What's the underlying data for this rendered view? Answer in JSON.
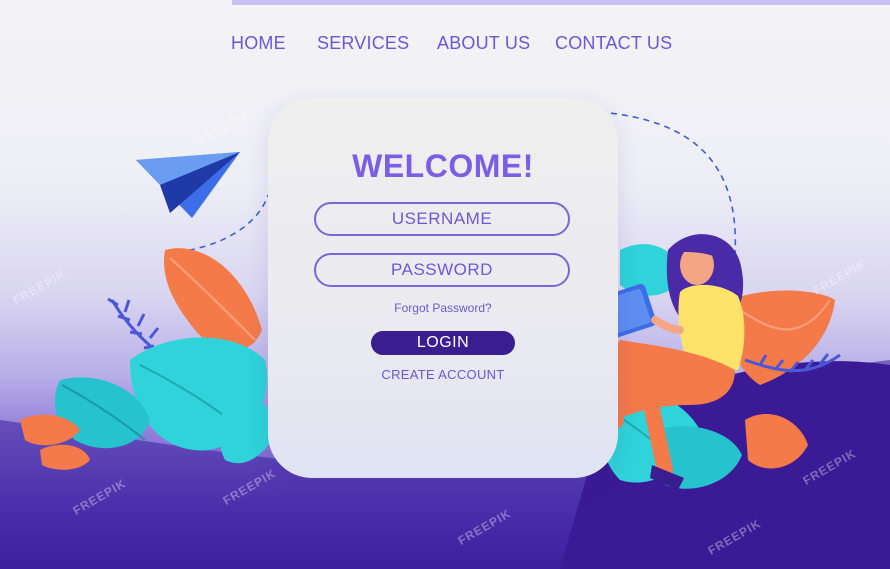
{
  "nav": {
    "home": "HOME",
    "services": "SERVICES",
    "about": "ABOUT US",
    "contact": "CONTACT US"
  },
  "login": {
    "title": "WELCOME!",
    "username_placeholder": "USERNAME",
    "password_placeholder": "PASSWORD",
    "forgot_link": "Forgot Password?",
    "login_button": "LOGIN",
    "create_account": "CREATE ACCOUNT"
  },
  "watermark": "FREEPIK",
  "colors": {
    "accent": "#7b5ee4",
    "button": "#3a1d8e",
    "leaf_cyan": "#2fd3d9",
    "leaf_orange": "#f47a4a",
    "leaf_blue": "#4a58d8",
    "plane": "#3b6ee8"
  }
}
